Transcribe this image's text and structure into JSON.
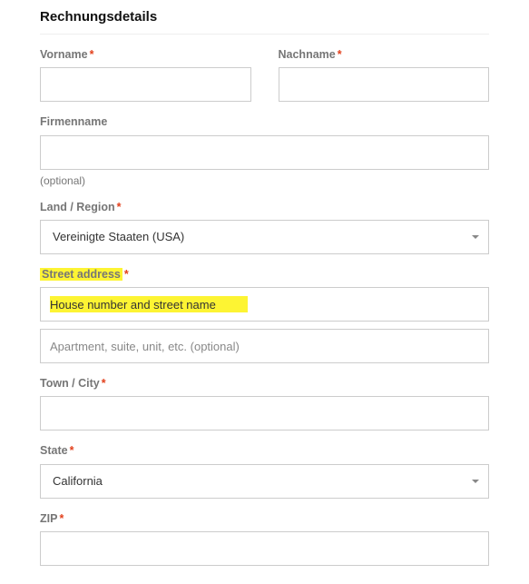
{
  "heading": "Rechnungsdetails",
  "required_marker": "*",
  "fields": {
    "first_name": {
      "label": "Vorname",
      "value": ""
    },
    "last_name": {
      "label": "Nachname",
      "value": ""
    },
    "company": {
      "label": "Firmenname",
      "optional_label": "(optional)",
      "value": ""
    },
    "country": {
      "label": "Land / Region",
      "selected": "Vereinigte Staaten (USA)"
    },
    "street": {
      "label": "Street address",
      "line1_placeholder": "House number and street name",
      "line2_placeholder": "Apartment, suite, unit, etc. (optional)",
      "line1_value": "",
      "line2_value": ""
    },
    "city": {
      "label": "Town / City",
      "value": ""
    },
    "state": {
      "label": "State",
      "selected": "California"
    },
    "zip": {
      "label": "ZIP",
      "value": ""
    }
  },
  "highlight_color": "#fdf433",
  "required_color": "#e2401c"
}
